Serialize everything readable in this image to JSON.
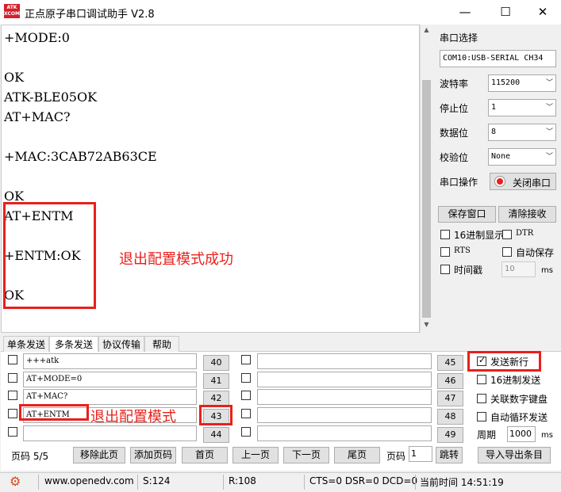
{
  "window": {
    "title": "正点原子串口调试助手 V2.8",
    "logo_text": "ATK XCOM",
    "minimize": "—",
    "maximize": "☐",
    "close": "✕"
  },
  "receive": {
    "lines": [
      "+MODE:0",
      "",
      "OK",
      "ATK-BLE05OK",
      "AT+MAC?",
      "",
      "+MAC:3CAB72AB63CE",
      "",
      "OK",
      "AT+ENTM",
      "",
      "+ENTM:OK",
      "",
      "OK"
    ],
    "annotation": "退出配置模式成功"
  },
  "panel": {
    "port_select_label": "串口选择",
    "port_value": "COM10:USB-SERIAL CH34",
    "baud_label": "波特率",
    "baud_value": "115200",
    "stopbit_label": "停止位",
    "stopbit_value": "1",
    "databit_label": "数据位",
    "databit_value": "8",
    "parity_label": "校验位",
    "parity_value": "None",
    "port_op_label": "串口操作",
    "close_port_label": "关闭串口",
    "save_window_label": "保存窗口",
    "clear_recv_label": "清除接收",
    "hex_display_label": "16进制显示",
    "dtr_label": "DTR",
    "rts_label": "RTS",
    "auto_save_label": "自动保存",
    "timestamp_label": "时间戳",
    "timestamp_value": "10",
    "ms_label": "ms"
  },
  "tabs": [
    {
      "label": "单条发送"
    },
    {
      "label": "多条发送"
    },
    {
      "label": "协议传输"
    },
    {
      "label": "帮助"
    }
  ],
  "multi_send": {
    "left_fields": [
      "+++atk",
      "AT+MODE=0",
      "AT+MAC?",
      "AT+ENTM",
      ""
    ],
    "left_nums": [
      "40",
      "41",
      "42",
      "43",
      "44"
    ],
    "right_fields": [
      "",
      "",
      "",
      "",
      ""
    ],
    "right_nums": [
      "45",
      "46",
      "47",
      "48",
      "49"
    ],
    "annotation": "退出配置模式"
  },
  "options": {
    "send_newline_label": "发送新行",
    "send_newline_checked": true,
    "hex_send_label": "16进制发送",
    "keypad_label": "关联数字键盘",
    "auto_loop_label": "自动循环发送",
    "period_label": "周期",
    "period_value": "1000",
    "period_unit": "ms"
  },
  "pager": {
    "page_label": "页码 5/5",
    "remove_label": "移除此页",
    "add_label": "添加页码",
    "first_label": "首页",
    "prev_label": "上一页",
    "next_label": "下一页",
    "last_label": "尾页",
    "goto_label": "页码",
    "goto_value": "1",
    "jump_label": "跳转",
    "io_label": "导入导出条目"
  },
  "status": {
    "site": "www.openedv.com",
    "sent": "S:124",
    "received": "R:108",
    "signals": "CTS=0 DSR=0 DCD=0",
    "time": "当前时间 14:51:19"
  },
  "colors": {
    "annotation": "#e8201c",
    "close_port_indicator": "#e8201c"
  }
}
